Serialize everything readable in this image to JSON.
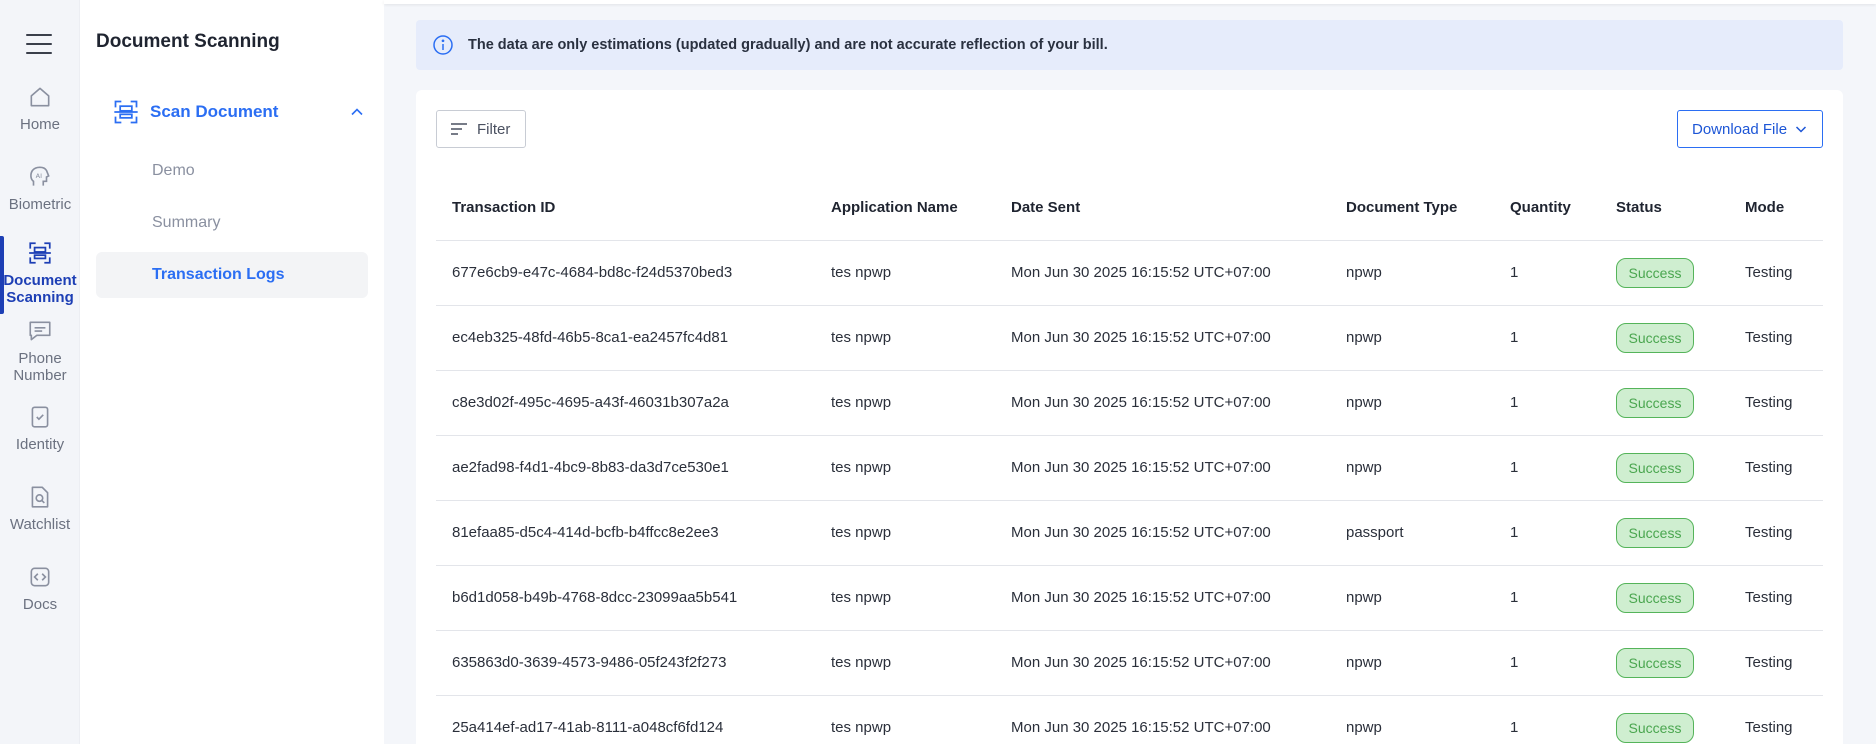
{
  "rail": {
    "items": [
      {
        "label": "Home",
        "icon": "home-icon",
        "active": false
      },
      {
        "label": "Biometric",
        "icon": "ai-face-icon",
        "active": false
      },
      {
        "label": "Document Scanning",
        "icon": "scan-document-icon",
        "active": true
      },
      {
        "label": "Phone Number",
        "icon": "message-icon",
        "active": false
      },
      {
        "label": "Identity",
        "icon": "check-file-icon",
        "active": false
      },
      {
        "label": "Watchlist",
        "icon": "search-file-icon",
        "active": false
      },
      {
        "label": "Docs",
        "icon": "code-icon",
        "active": false
      }
    ]
  },
  "subnav": {
    "title": "Document Scanning",
    "group": {
      "label": "Scan Document",
      "expanded": true
    },
    "items": [
      {
        "label": "Demo",
        "active": false
      },
      {
        "label": "Summary",
        "active": false
      },
      {
        "label": "Transaction Logs",
        "active": true
      }
    ]
  },
  "notice": {
    "text": "The data are only estimations (updated gradually) and are not accurate reflection of your bill."
  },
  "toolbar": {
    "filter_label": "Filter",
    "download_label": "Download File"
  },
  "table": {
    "headers": [
      "Transaction ID",
      "Application Name",
      "Date Sent",
      "Document Type",
      "Quantity",
      "Status",
      "Mode"
    ],
    "rows": [
      [
        "677e6cb9-e47c-4684-bd8c-f24d5370bed3",
        "tes npwp",
        "Mon Jun 30 2025 16:15:52 UTC+07:00",
        "npwp",
        "1",
        "Success",
        "Testing"
      ],
      [
        "ec4eb325-48fd-46b5-8ca1-ea2457fc4d81",
        "tes npwp",
        "Mon Jun 30 2025 16:15:52 UTC+07:00",
        "npwp",
        "1",
        "Success",
        "Testing"
      ],
      [
        "c8e3d02f-495c-4695-a43f-46031b307a2a",
        "tes npwp",
        "Mon Jun 30 2025 16:15:52 UTC+07:00",
        "npwp",
        "1",
        "Success",
        "Testing"
      ],
      [
        "ae2fad98-f4d1-4bc9-8b83-da3d7ce530e1",
        "tes npwp",
        "Mon Jun 30 2025 16:15:52 UTC+07:00",
        "npwp",
        "1",
        "Success",
        "Testing"
      ],
      [
        "81efaa85-d5c4-414d-bcfb-b4ffcc8e2ee3",
        "tes npwp",
        "Mon Jun 30 2025 16:15:52 UTC+07:00",
        "passport",
        "1",
        "Success",
        "Testing"
      ],
      [
        "b6d1d058-b49b-4768-8dcc-23099aa5b541",
        "tes npwp",
        "Mon Jun 30 2025 16:15:52 UTC+07:00",
        "npwp",
        "1",
        "Success",
        "Testing"
      ],
      [
        "635863d0-3639-4573-9486-05f243f2f273",
        "tes npwp",
        "Mon Jun 30 2025 16:15:52 UTC+07:00",
        "npwp",
        "1",
        "Success",
        "Testing"
      ],
      [
        "25a414ef-ad17-41ab-8111-a048cf6fd124",
        "tes npwp",
        "Mon Jun 30 2025 16:15:52 UTC+07:00",
        "npwp",
        "1",
        "Success",
        "Testing"
      ]
    ]
  },
  "colors": {
    "accent": "#2b6ef3",
    "rail_active": "#1d3fb5",
    "success_bg": "#cfeed0",
    "success_border": "#55b45a",
    "notice_bg": "#e6ecfb"
  }
}
